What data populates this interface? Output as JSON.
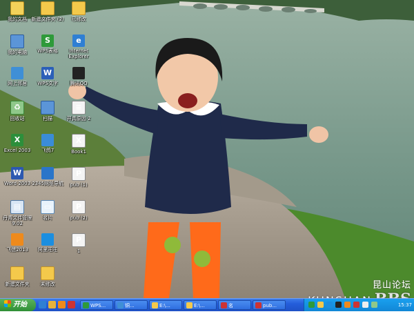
{
  "desktop": {
    "icons": [
      {
        "name": "my-documents-icon",
        "label": "我的文档"
      },
      {
        "name": "new-folder-2-icon",
        "label": "新建文件夹 (2)"
      },
      {
        "name": "archived-folder-icon",
        "label": "已修改"
      },
      {
        "name": "my-computer-icon",
        "label": "我的电脑"
      },
      {
        "name": "s-app-icon",
        "label": "WPS表格"
      },
      {
        "name": "internet-explorer-icon",
        "label": "Internet Explorer"
      },
      {
        "name": "network-places-icon",
        "label": "网上邻居"
      },
      {
        "name": "wps-writer-icon",
        "label": "WPS文字"
      },
      {
        "name": "qq-icon",
        "label": "腾讯QQ"
      },
      {
        "name": "recycle-bin-icon",
        "label": "回收站"
      },
      {
        "name": "scanner-icon",
        "label": "扫描"
      },
      {
        "name": "text-document-icon",
        "label": "开具原因 2"
      },
      {
        "name": "excel-2003-icon",
        "label": "Excel 2003"
      },
      {
        "name": "feige-icon",
        "label": "飞鸽7"
      },
      {
        "name": "book1-icon",
        "label": "Book1"
      },
      {
        "name": "word-2003-icon",
        "label": "Word 2003"
      },
      {
        "name": "nav-2345-icon",
        "label": "2345网址导航"
      },
      {
        "name": "pub-1-icon",
        "label": "pub (1)"
      },
      {
        "name": "file-manager-icon",
        "label": "丹青文件管理 9.02"
      },
      {
        "name": "business-card-icon",
        "label": "名片"
      },
      {
        "name": "pub-2-icon",
        "label": "pub (2)"
      },
      {
        "name": "flyer-2013-icon",
        "label": "飞信2013"
      },
      {
        "name": "aliwangwang-icon",
        "label": "阿里旺旺"
      },
      {
        "name": "file-1-icon",
        "label": "1"
      },
      {
        "name": "new-folder-icon",
        "label": "新建文件夹"
      },
      {
        "name": "unmodified-folder-icon",
        "label": "未修改"
      }
    ]
  },
  "watermark": {
    "chinese": "昆山论坛",
    "english": "KUNSHAN",
    "bbs": "BBS"
  },
  "taskbar": {
    "start_label": "开始",
    "tasks": [
      {
        "label": "WPS..."
      },
      {
        "label": "铜..."
      },
      {
        "label": "E:\\..."
      },
      {
        "label": "E:\\..."
      },
      {
        "label": "名"
      },
      {
        "label": "pub..."
      }
    ],
    "clock": "15:37"
  }
}
